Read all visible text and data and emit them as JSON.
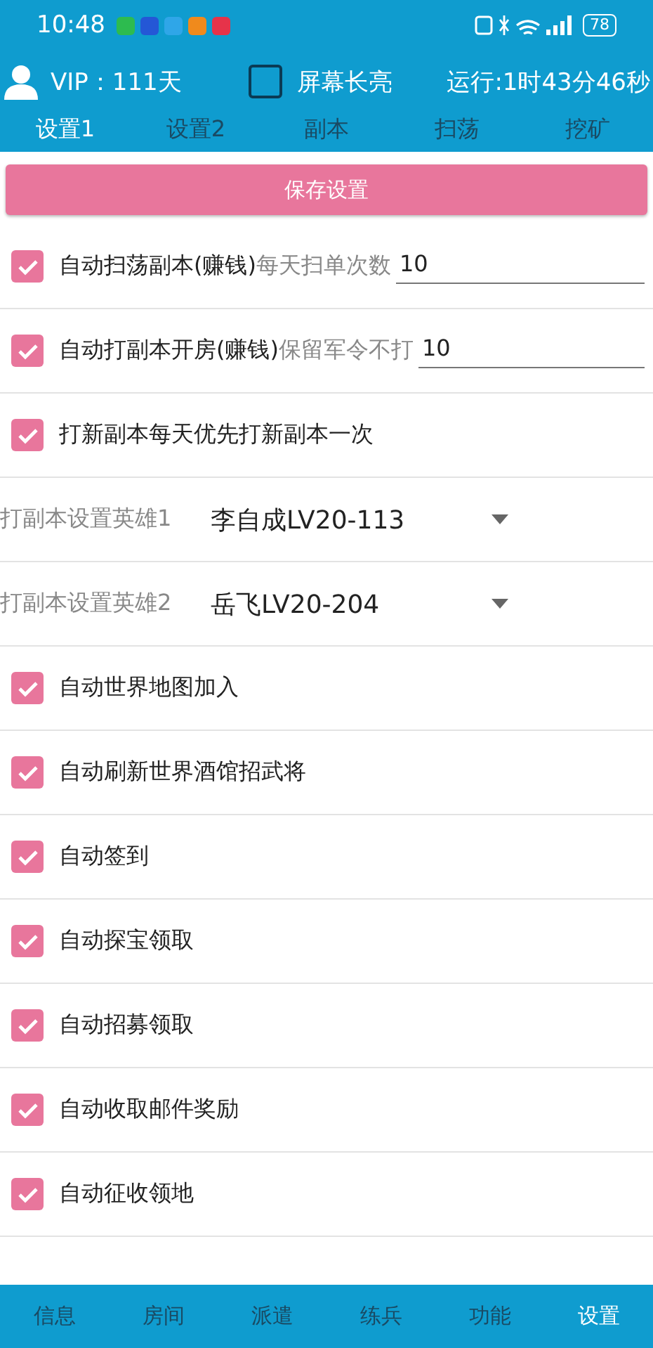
{
  "status_bar": {
    "time": "10:48",
    "battery": "78"
  },
  "header": {
    "vip": "VIP：111天",
    "keep_screen_on": {
      "label": "屏幕长亮",
      "checked": false
    },
    "runtime": "运行:1时43分46秒"
  },
  "tabs": [
    {
      "label": "设置1",
      "selected": true
    },
    {
      "label": "设置2",
      "selected": false
    },
    {
      "label": "副本",
      "selected": false
    },
    {
      "label": "扫荡",
      "selected": false
    },
    {
      "label": "挖矿",
      "selected": false
    }
  ],
  "save_button": "保存设置",
  "settings": [
    {
      "kind": "check_input",
      "label": "自动扫荡副本(赚钱)",
      "hint": "每天扫单次数",
      "value": "10",
      "checked": true
    },
    {
      "kind": "check_input",
      "label": "自动打副本开房(赚钱)",
      "hint": "保留军令不打",
      "value": "10",
      "checked": true
    },
    {
      "kind": "check",
      "label": "打新副本每天优先打新副本一次",
      "checked": true
    },
    {
      "kind": "select",
      "label": "打副本设置英雄1",
      "value": "李自成LV20-113"
    },
    {
      "kind": "select",
      "label": "打副本设置英雄2",
      "value": "岳飞LV20-204"
    },
    {
      "kind": "check",
      "label": "自动世界地图加入",
      "checked": true
    },
    {
      "kind": "check",
      "label": "自动刷新世界酒馆招武将",
      "checked": true
    },
    {
      "kind": "check",
      "label": "自动签到",
      "checked": true
    },
    {
      "kind": "check",
      "label": "自动探宝领取",
      "checked": true
    },
    {
      "kind": "check",
      "label": "自动招募领取",
      "checked": true
    },
    {
      "kind": "check",
      "label": "自动收取邮件奖励",
      "checked": true
    },
    {
      "kind": "check",
      "label": "自动征收领地",
      "checked": true
    }
  ],
  "bottom_nav": [
    {
      "label": "信息",
      "selected": false
    },
    {
      "label": "房间",
      "selected": false
    },
    {
      "label": "派遣",
      "selected": false
    },
    {
      "label": "练兵",
      "selected": false
    },
    {
      "label": "功能",
      "selected": false
    },
    {
      "label": "设置",
      "selected": true
    }
  ]
}
